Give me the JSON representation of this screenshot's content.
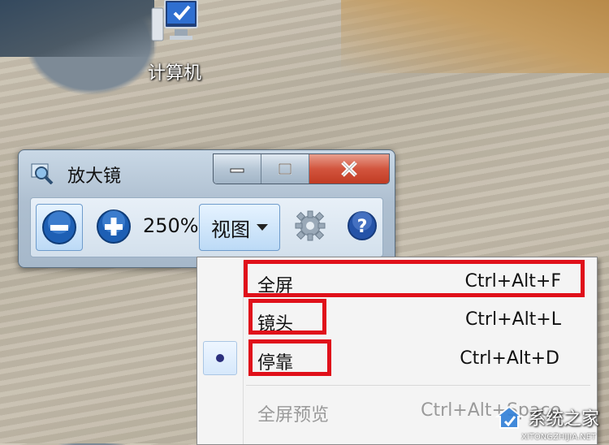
{
  "desktop": {
    "icon_label": "计算机"
  },
  "magnifier": {
    "title": "放大镜",
    "zoom_level": "250%",
    "view_label": "视图",
    "icons": {
      "app": "magnifier-icon",
      "minimize": "minimize-icon",
      "maximize": "maximize-icon",
      "close": "close-icon",
      "zoom_out": "zoom-out-icon",
      "zoom_in": "zoom-in-icon",
      "options": "gear-icon",
      "help": "help-icon"
    }
  },
  "view_menu": {
    "items": [
      {
        "label": "全屏",
        "shortcut": "Ctrl+Alt+F",
        "checked": false,
        "enabled": true
      },
      {
        "label": "镜头",
        "shortcut": "Ctrl+Alt+L",
        "checked": false,
        "enabled": true
      },
      {
        "label": "停靠",
        "shortcut": "Ctrl+Alt+D",
        "checked": true,
        "enabled": true
      },
      {
        "label": "全屏预览",
        "shortcut": "Ctrl+Alt+Space",
        "checked": false,
        "enabled": false
      }
    ]
  },
  "watermark": {
    "text": "系统之家",
    "sub": "XITONGZHIJIA.NET"
  },
  "colors": {
    "highlight": "#e0101a",
    "accent_blue": "#1d5fb4"
  }
}
